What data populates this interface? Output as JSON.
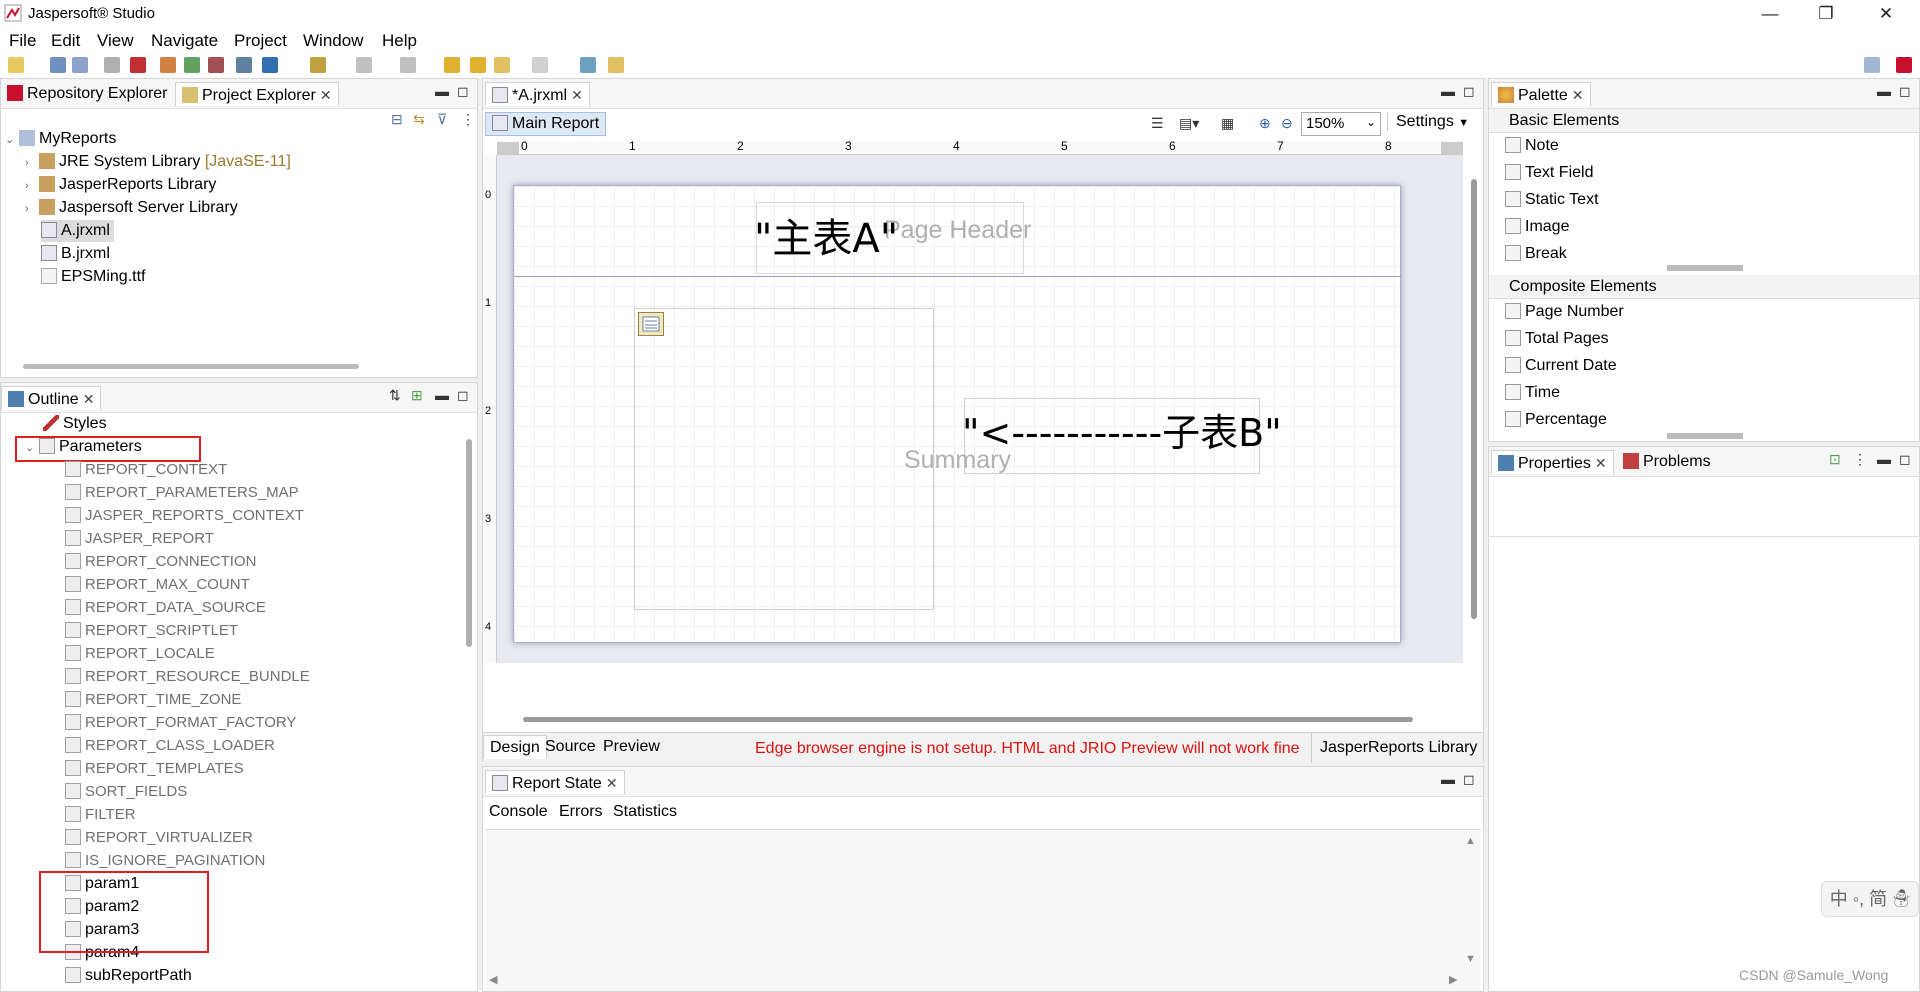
{
  "app": {
    "title": "Jaspersoft® Studio",
    "brand_color": "#c8102e"
  },
  "window_controls": {
    "minimize": "—",
    "restore": "❐",
    "close": "✕"
  },
  "menu": [
    "File",
    "Edit",
    "View",
    "Navigate",
    "Project",
    "Window",
    "Help"
  ],
  "left_top": {
    "tabs": [
      "Repository Explorer",
      "Project Explorer"
    ],
    "tree": [
      {
        "label": "MyReports",
        "expanded": true,
        "icon": "project-icon"
      },
      {
        "label": "JRE System Library",
        "suffix": "[JavaSE-11]",
        "icon": "library-icon"
      },
      {
        "label": "JasperReports Library",
        "icon": "library-icon"
      },
      {
        "label": "Jaspersoft Server Library",
        "icon": "library-icon"
      },
      {
        "label": "A.jrxml",
        "selected": true,
        "icon": "report-file-icon"
      },
      {
        "label": "B.jrxml",
        "icon": "report-file-icon"
      },
      {
        "label": "EPSMing.ttf",
        "icon": "font-file-icon"
      }
    ]
  },
  "outline": {
    "tab": "Outline",
    "styles": "Styles",
    "parameters": "Parameters",
    "builtin_params": [
      "REPORT_CONTEXT",
      "REPORT_PARAMETERS_MAP",
      "JASPER_REPORTS_CONTEXT",
      "JASPER_REPORT",
      "REPORT_CONNECTION",
      "REPORT_MAX_COUNT",
      "REPORT_DATA_SOURCE",
      "REPORT_SCRIPTLET",
      "REPORT_LOCALE",
      "REPORT_RESOURCE_BUNDLE",
      "REPORT_TIME_ZONE",
      "REPORT_FORMAT_FACTORY",
      "REPORT_CLASS_LOADER",
      "REPORT_TEMPLATES",
      "SORT_FIELDS",
      "FILTER",
      "REPORT_VIRTUALIZER",
      "IS_IGNORE_PAGINATION"
    ],
    "user_params": [
      "param1",
      "param2",
      "param3",
      "param4",
      "subReportPath"
    ]
  },
  "editor": {
    "tab": "*A.jrxml",
    "main_report": "Main Report",
    "zoom": "150%",
    "settings": "Settings",
    "ruler": [
      "0",
      "1",
      "2",
      "3",
      "4",
      "5",
      "6",
      "7",
      "8"
    ],
    "vruler": [
      "0",
      "1",
      "2",
      "3",
      "4"
    ],
    "band_page_header": "Page Header",
    "band_summary": "Summary",
    "text_main": "\"主表A\"",
    "text_sub": "\"<-----------子表B\"",
    "bottom_tabs": [
      "Design",
      "Source",
      "Preview"
    ],
    "warning": "Edge browser engine is not setup. HTML and JRIO Preview will not work fine",
    "library_btn": "JasperReports Library"
  },
  "report_state": {
    "tab": "Report State",
    "subtabs": [
      "Console",
      "Errors",
      "Statistics"
    ]
  },
  "palette": {
    "tab": "Palette",
    "basic_header": "Basic Elements",
    "basic": [
      "Note",
      "Text Field",
      "Static Text",
      "Image",
      "Break"
    ],
    "composite_header": "Composite Elements",
    "composite": [
      "Page Number",
      "Total Pages",
      "Current Date",
      "Time",
      "Percentage"
    ]
  },
  "properties": {
    "tabs": [
      "Properties",
      "Problems"
    ]
  },
  "ime": "中 ◦, 简 ☃",
  "watermark": "CSDN @Samule_Wong"
}
